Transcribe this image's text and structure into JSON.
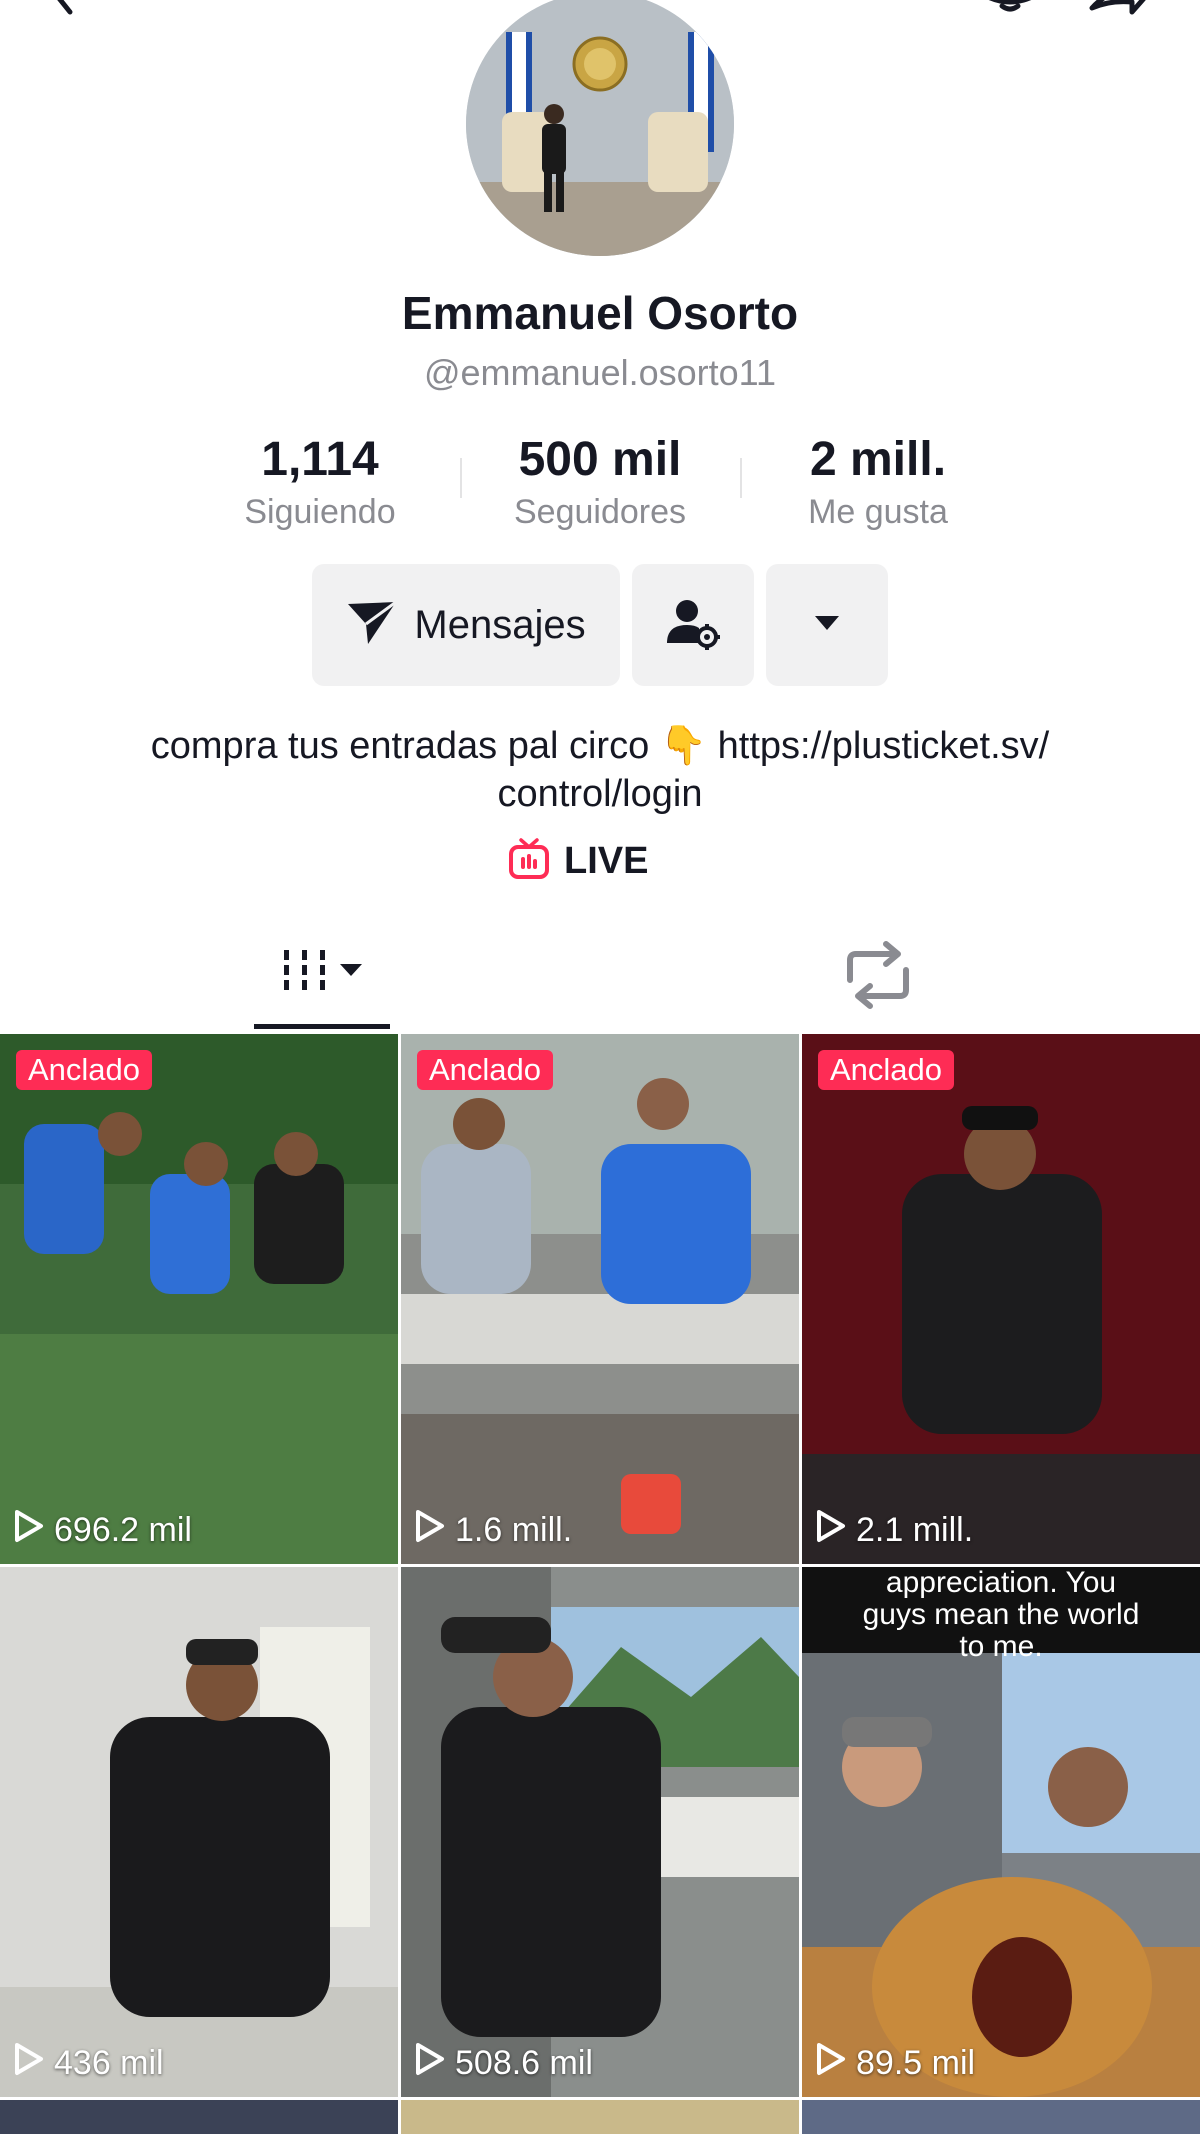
{
  "profile": {
    "display_name": "Emmanuel Osorto",
    "username": "@emmanuel.osorto11",
    "bio_line1": "compra tus entradas pal circo 👇 https://plusticket.sv/",
    "bio_line2": "control/login",
    "live_label": "LIVE"
  },
  "stats": [
    {
      "value": "1,114",
      "label": "Siguiendo"
    },
    {
      "value": "500 mil",
      "label": "Seguidores"
    },
    {
      "value": "2 mill.",
      "label": "Me gusta"
    }
  ],
  "actions": {
    "messages_label": "Mensajes"
  },
  "icons": {
    "top": [
      "back-icon",
      "bell-icon",
      "share-icon"
    ],
    "tabs": [
      "videos-grid-icon",
      "repost-icon"
    ]
  },
  "colors": {
    "accent": "#fe2c55",
    "text": "#161823",
    "muted": "#8a8b91",
    "button_bg": "#f1f1f2"
  },
  "videos": [
    {
      "pinned_label": "Anclado",
      "views": "696.2 mil"
    },
    {
      "pinned_label": "Anclado",
      "views": "1.6 mill."
    },
    {
      "pinned_label": "Anclado",
      "views": "2.1 mill."
    },
    {
      "views": "436 mil"
    },
    {
      "views": "508.6 mil"
    },
    {
      "views": "89.5 mil",
      "caption_line1": "appreciation. You",
      "caption_line2": "guys mean the world",
      "caption_line3": "to me."
    }
  ]
}
